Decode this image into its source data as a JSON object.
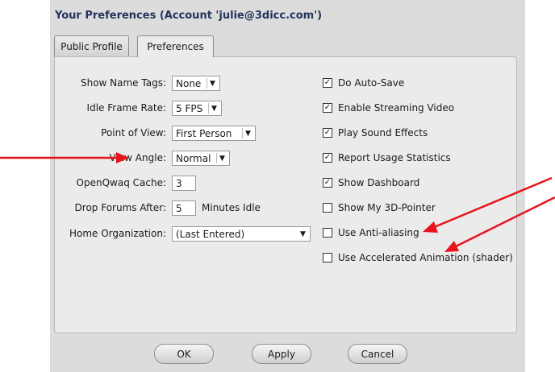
{
  "window": {
    "title": "Your Preferences (Account 'julie@3dicc.com')"
  },
  "tabs": [
    {
      "label": "Public Profile"
    },
    {
      "label": "Preferences"
    }
  ],
  "left": {
    "show_name_tags": {
      "label": "Show Name Tags:",
      "value": "None"
    },
    "idle_frame_rate": {
      "label": "Idle Frame Rate:",
      "value": "5 FPS"
    },
    "point_of_view": {
      "label": "Point of View:",
      "value": "First Person"
    },
    "view_angle": {
      "label": "View Angle:",
      "value": "Normal"
    },
    "cache": {
      "label": "OpenQwaq Cache:",
      "value": "3"
    },
    "drop_forums": {
      "label": "Drop Forums After:",
      "value": "5",
      "suffix": "Minutes Idle"
    },
    "home_org": {
      "label": "Home Organization:",
      "value": "(Last Entered)"
    }
  },
  "checkboxes": [
    {
      "label": "Do Auto-Save",
      "checked": true
    },
    {
      "label": "Enable Streaming Video",
      "checked": true
    },
    {
      "label": "Play Sound Effects",
      "checked": true
    },
    {
      "label": "Report Usage Statistics",
      "checked": true
    },
    {
      "label": "Show Dashboard",
      "checked": true
    },
    {
      "label": "Show My 3D-Pointer",
      "checked": false
    },
    {
      "label": "Use Anti-aliasing",
      "checked": false
    },
    {
      "label": "Use Accelerated Animation (shader)",
      "checked": false
    }
  ],
  "buttons": {
    "ok": "OK",
    "apply": "Apply",
    "cancel": "Cancel"
  },
  "colors": {
    "annotation_arrow": "#e8141b",
    "title": "#23345c"
  },
  "icons": {
    "dropdown": "triangle-down-icon",
    "check": "check-icon"
  }
}
